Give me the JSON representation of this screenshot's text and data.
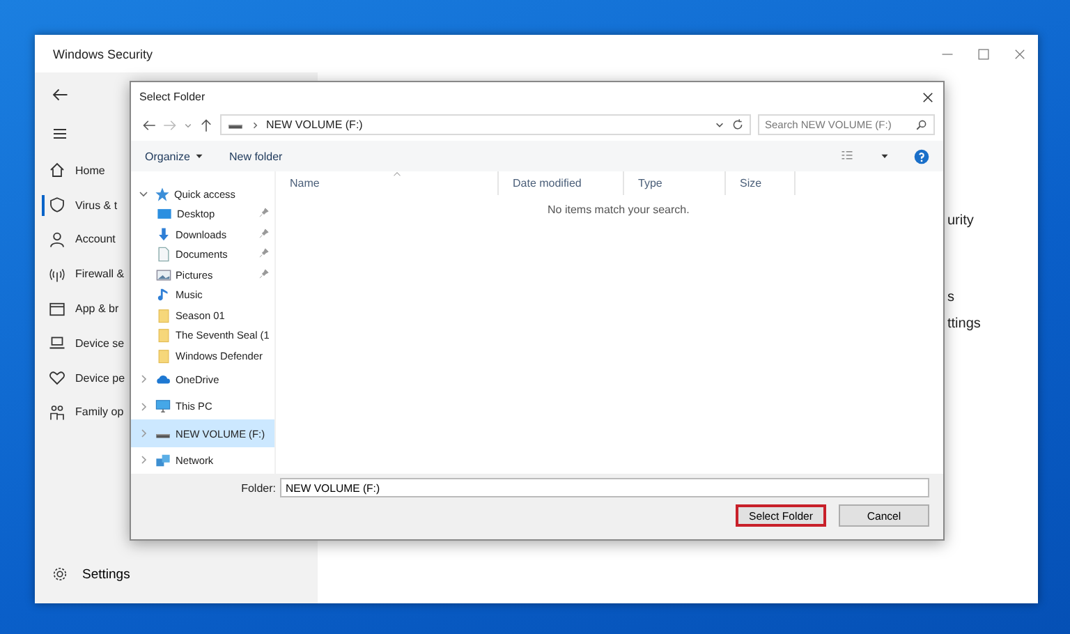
{
  "security_window": {
    "title": "Windows Security",
    "nav_items": [
      {
        "label": "Home",
        "kind": "home",
        "selected": false
      },
      {
        "label": "Virus & t",
        "kind": "shield",
        "selected": true
      },
      {
        "label": "Account",
        "kind": "person",
        "selected": false
      },
      {
        "label": "Firewall &",
        "kind": "antenna",
        "selected": false
      },
      {
        "label": "App & br",
        "kind": "window",
        "selected": false
      },
      {
        "label": "Device se",
        "kind": "laptop",
        "selected": false
      },
      {
        "label": "Device pe",
        "kind": "heart",
        "selected": false
      },
      {
        "label": "Family op",
        "kind": "family",
        "selected": false
      }
    ],
    "settings_label": "Settings",
    "main_fragments": [
      "urity",
      "s",
      "ttings"
    ]
  },
  "dialog": {
    "title": "Select Folder",
    "address": {
      "path": "NEW VOLUME (F:)"
    },
    "search": {
      "placeholder": "Search NEW VOLUME (F:)"
    },
    "commands": [
      "Organize",
      "New folder"
    ],
    "nav_tree": [
      {
        "label": "Quick access",
        "kind": "star",
        "expanded": true,
        "selected": false,
        "children": [
          {
            "label": "Desktop",
            "kind": "desktop",
            "pinned": true,
            "selected": false
          },
          {
            "label": "Downloads",
            "kind": "download",
            "pinned": true,
            "selected": false
          },
          {
            "label": "Documents",
            "kind": "document",
            "pinned": true,
            "selected": false
          },
          {
            "label": "Pictures",
            "kind": "picture",
            "pinned": true,
            "selected": false
          },
          {
            "label": "Music",
            "kind": "music",
            "pinned": false,
            "selected": false
          },
          {
            "label": "Season 01",
            "kind": "folder",
            "pinned": false,
            "selected": false
          },
          {
            "label": "The Seventh Seal (1",
            "kind": "folder",
            "pinned": false,
            "selected": false
          },
          {
            "label": "Windows Defender",
            "kind": "folder",
            "pinned": false,
            "selected": false
          }
        ]
      },
      {
        "label": "OneDrive",
        "kind": "cloud",
        "expanded": false,
        "selected": false
      },
      {
        "label": "This PC",
        "kind": "pc",
        "expanded": false,
        "selected": false
      },
      {
        "label": "NEW VOLUME (F:)",
        "kind": "drive",
        "expanded": false,
        "selected": true
      },
      {
        "label": "Network",
        "kind": "network",
        "expanded": false,
        "selected": false
      }
    ],
    "columns": [
      "Name",
      "Date modified",
      "Type",
      "Size"
    ],
    "empty_message": "No items match your search.",
    "folder_label": "Folder:",
    "folder_value": "NEW VOLUME (F:)",
    "buttons": [
      {
        "label": "Select Folder",
        "highlighted": true
      },
      {
        "label": "Cancel",
        "highlighted": false
      }
    ]
  }
}
